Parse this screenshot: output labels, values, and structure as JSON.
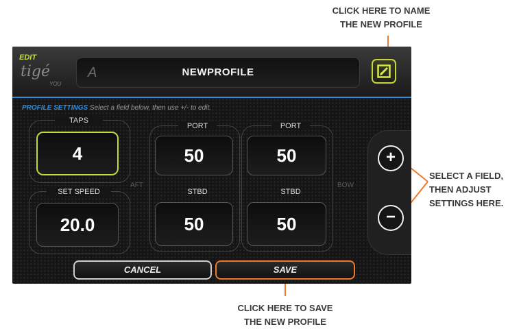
{
  "callouts": {
    "name_profile": [
      "CLICK HERE TO NAME",
      "THE NEW PROFILE"
    ],
    "adjust": [
      "SELECT A FIELD,",
      "THEN ADJUST",
      "SETTINGS HERE."
    ],
    "save_profile": [
      "CLICK HERE TO SAVE",
      "THE NEW PROFILE"
    ]
  },
  "header": {
    "edit_tag": "EDIT",
    "brand": "tigé",
    "brand_sub": "YOU",
    "profile_name": "NEWPROFILE"
  },
  "settings": {
    "label": "PROFILE SETTINGS",
    "hint": "Select a field below, then use +/- to edit."
  },
  "fields": {
    "taps": {
      "label": "TAPS",
      "value": "4"
    },
    "set_speed": {
      "label": "SET SPEED",
      "value": "20.0"
    },
    "aft_port": {
      "label": "PORT",
      "value": "50"
    },
    "aft_stbd": {
      "label": "STBD",
      "value": "50"
    },
    "bow_port": {
      "label": "PORT",
      "value": "50"
    },
    "bow_stbd": {
      "label": "STBD",
      "value": "50"
    }
  },
  "side_labels": {
    "aft": "AFT",
    "bow": "BOW"
  },
  "controls": {
    "plus": "+",
    "minus": "−"
  },
  "buttons": {
    "cancel": "CANCEL",
    "save": "SAVE"
  },
  "colors": {
    "accent_lime": "#c5d83a",
    "accent_orange": "#f07a2a",
    "settings_blue": "#2e8fe0"
  },
  "icons": {
    "edit": "edit-pencil-icon",
    "plus": "plus-circle-icon",
    "minus": "minus-circle-icon"
  }
}
